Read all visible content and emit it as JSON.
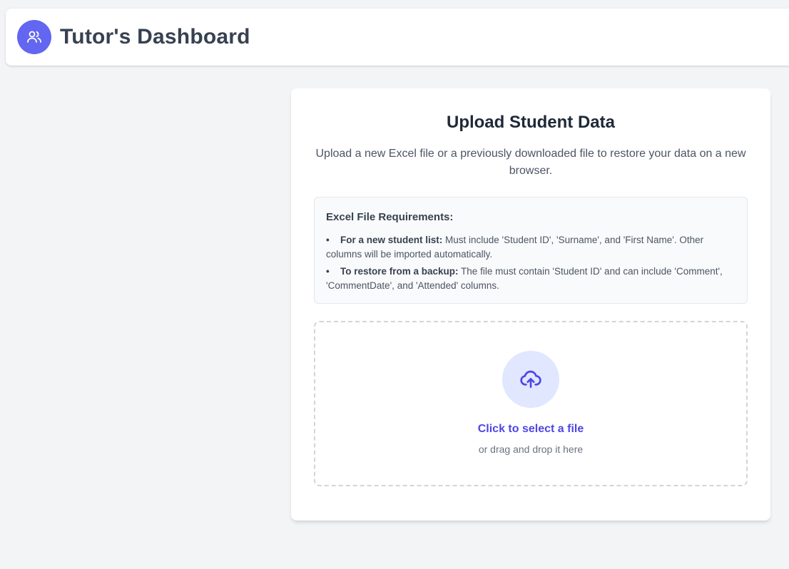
{
  "header": {
    "title": "Tutor's Dashboard",
    "logo_icon": "users-icon",
    "logo_color": "#6366f1"
  },
  "upload": {
    "title": "Upload Student Data",
    "description": "Upload a new Excel file or a previously downloaded file to restore your data on a new browser.",
    "requirements": {
      "heading": "Excel File Requirements:",
      "items": [
        {
          "label": "For a new student list:",
          "text": " Must include 'Student ID', 'Surname', and 'First Name'. Other columns will be imported automatically."
        },
        {
          "label": "To restore from a backup:",
          "text": " The file must contain 'Student ID' and can include 'Comment', 'CommentDate', and 'Attended' columns."
        }
      ]
    },
    "dropzone": {
      "icon": "cloud-upload-icon",
      "link_label": "Click to select a file",
      "hint": "or drag and drop it here",
      "accent_color": "#4f46e5"
    }
  }
}
